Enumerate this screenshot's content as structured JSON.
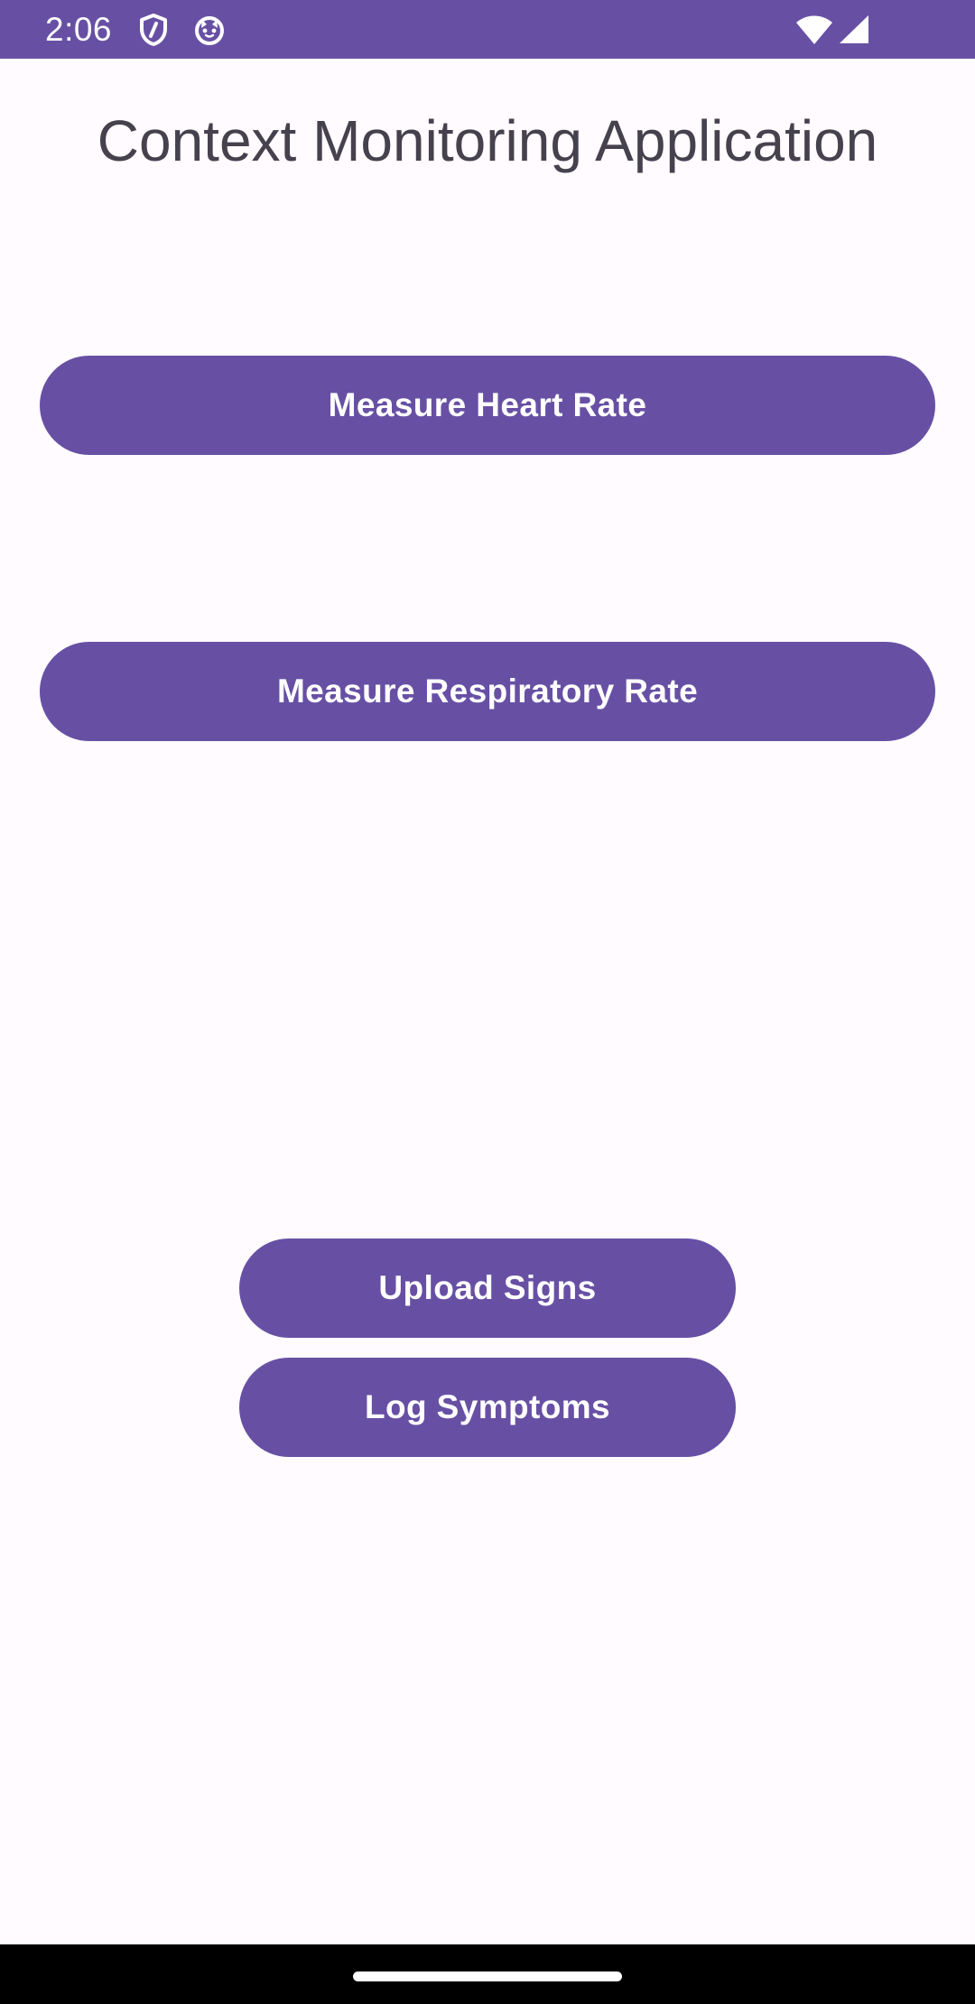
{
  "status_bar": {
    "time": "2:06",
    "background_color": "#6750A4",
    "icons": [
      "shield-icon",
      "cat-face-icon",
      "wifi-icon",
      "cell-signal-icon"
    ]
  },
  "app": {
    "title": "Context Monitoring Application",
    "accent_color": "#6750A4",
    "background_color": "#FFFBFE"
  },
  "buttons": {
    "heart_rate": "Measure Heart Rate",
    "respiratory_rate": "Measure Respiratory Rate",
    "upload_signs": "Upload Signs",
    "log_symptoms": "Log Symptoms"
  }
}
